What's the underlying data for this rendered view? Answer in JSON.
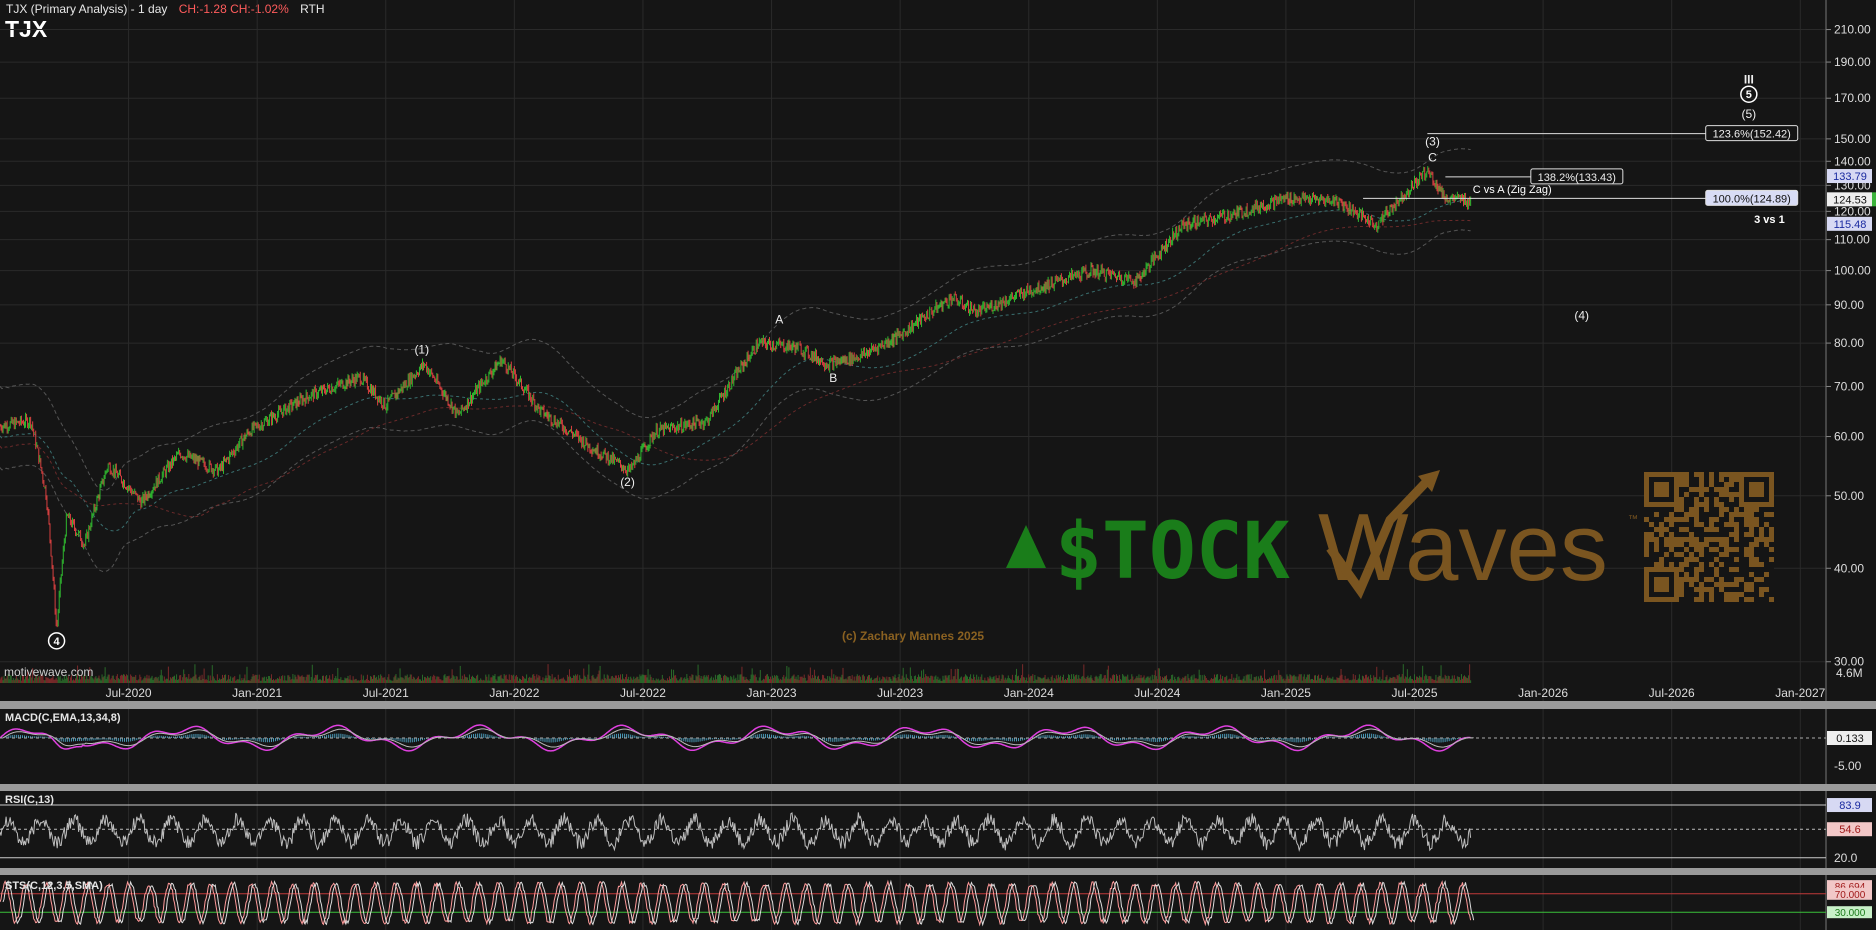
{
  "header": {
    "title": "TJX (Primary Analysis) - 1 day",
    "change": "CH:-1.28  CH:-1.02%",
    "session": "RTH",
    "symbol": "TJX"
  },
  "source_label": "motivewave.com",
  "copyright": "(c) Zachary Mannes 2025",
  "watermark": {
    "brand": "$TOCK",
    "brand2": "Waves",
    "tm": "™"
  },
  "colors": {
    "background": "#151515",
    "grid": "#2a2a2a",
    "up": "#2fb82f",
    "down": "#d94040",
    "macd": "#e040e0",
    "brand_green": "#1a7d1a",
    "brand_brown": "#7a5520"
  },
  "chart_data": [
    {
      "type": "candlestick",
      "panel": "price",
      "title": "TJX (Primary Analysis) - 1 day",
      "scale": "log",
      "ylim": [
        27.5,
        230
      ],
      "y_ticks": [
        "210.00",
        "190.00",
        "170.00",
        "150.00",
        "140.00",
        "130.00",
        "120.00",
        "110.00",
        "100.00",
        "90.00",
        "80.00",
        "70.00",
        "60.00",
        "50.00",
        "40.00",
        "30.00"
      ],
      "x_ticks": [
        "Jul-2020",
        "Jan-2021",
        "Jul-2021",
        "Jan-2022",
        "Jul-2022",
        "Jan-2023",
        "Jul-2023",
        "Jan-2024",
        "Jul-2024",
        "Jan-2025",
        "Jul-2025",
        "Jan-2026",
        "Jul-2026",
        "Jan-2027"
      ],
      "x_tick_years": [
        2020.5,
        2021.0,
        2021.5,
        2022.0,
        2022.5,
        2023.0,
        2023.5,
        2024.0,
        2024.5,
        2025.0,
        2025.5,
        2026.0,
        2026.5,
        2027.0
      ],
      "x_range": [
        2020.0,
        2027.1
      ],
      "price_path": [
        [
          2020.0,
          62
        ],
        [
          2020.12,
          63
        ],
        [
          2020.18,
          50
        ],
        [
          2020.22,
          33
        ],
        [
          2020.26,
          47
        ],
        [
          2020.33,
          43
        ],
        [
          2020.42,
          55
        ],
        [
          2020.55,
          49
        ],
        [
          2020.7,
          57
        ],
        [
          2020.85,
          54
        ],
        [
          2020.97,
          61
        ],
        [
          2021.2,
          68
        ],
        [
          2021.4,
          72
        ],
        [
          2021.5,
          66
        ],
        [
          2021.65,
          75
        ],
        [
          2021.78,
          64
        ],
        [
          2021.95,
          76
        ],
        [
          2022.1,
          65
        ],
        [
          2022.3,
          58
        ],
        [
          2022.45,
          54
        ],
        [
          2022.55,
          61
        ],
        [
          2022.75,
          63
        ],
        [
          2022.95,
          80
        ],
        [
          2023.1,
          79
        ],
        [
          2023.22,
          75
        ],
        [
          2023.35,
          77
        ],
        [
          2023.5,
          82
        ],
        [
          2023.7,
          92
        ],
        [
          2023.8,
          88
        ],
        [
          2024.0,
          94
        ],
        [
          2024.25,
          100
        ],
        [
          2024.42,
          97
        ],
        [
          2024.6,
          115
        ],
        [
          2024.8,
          119
        ],
        [
          2025.0,
          125
        ],
        [
          2025.2,
          124
        ],
        [
          2025.35,
          115
        ],
        [
          2025.55,
          136
        ],
        [
          2025.62,
          125
        ],
        [
          2025.72,
          124
        ]
      ],
      "last_price": "124.53",
      "markers": [
        {
          "label": "133.79",
          "value": 133.79
        },
        {
          "label": "124.53",
          "value": 124.53
        },
        {
          "label": "115.48",
          "value": 115.48
        }
      ],
      "fib_levels": [
        {
          "label": "123.6%(152.42)",
          "value": 152.42
        },
        {
          "label": "138.2%(133.43)",
          "value": 133.43
        },
        {
          "label": "100.0%(124.89)",
          "value": 124.89
        }
      ],
      "wave_labels": [
        {
          "text": "4",
          "x": 2020.22,
          "value": 31.6,
          "style": "circle"
        },
        {
          "text": "(1)",
          "x": 2021.64,
          "value": 77.5
        },
        {
          "text": "(2)",
          "x": 2022.44,
          "value": 51.5
        },
        {
          "text": "A",
          "x": 2023.03,
          "value": 85
        },
        {
          "text": "B",
          "x": 2023.24,
          "value": 71
        },
        {
          "text": "(3)",
          "x": 2025.57,
          "value": 147
        },
        {
          "text": "C",
          "x": 2025.57,
          "value": 140
        },
        {
          "text": "(4)",
          "x": 2026.15,
          "value": 86
        },
        {
          "text": "III",
          "x": 2026.8,
          "value": 178
        },
        {
          "text": "5",
          "x": 2026.8,
          "value": 170,
          "style": "circle"
        },
        {
          "text": "(5)",
          "x": 2026.8,
          "value": 160
        }
      ],
      "annotations": [
        "C vs A (Zig Zag)",
        "3 vs 1"
      ],
      "volume_label": "4.6M"
    },
    {
      "type": "line",
      "panel": "macd",
      "title": "MACD(C,EMA,13,34,8)",
      "y_ticks": [
        "-5.00"
      ],
      "last_value": "0.133"
    },
    {
      "type": "line",
      "panel": "rsi",
      "title": "RSI(C,13)",
      "y_ticks": [
        "20.0"
      ],
      "levels": [
        83.9,
        54.6
      ],
      "level_labels": [
        "83.9",
        "54.6"
      ]
    },
    {
      "type": "line",
      "panel": "stochastic",
      "title": "STS(C,12,3,5,SMA)",
      "levels": [
        86.694,
        70.0,
        30.0
      ],
      "level_labels": [
        "86.694",
        "70.000",
        "30.000"
      ]
    }
  ]
}
